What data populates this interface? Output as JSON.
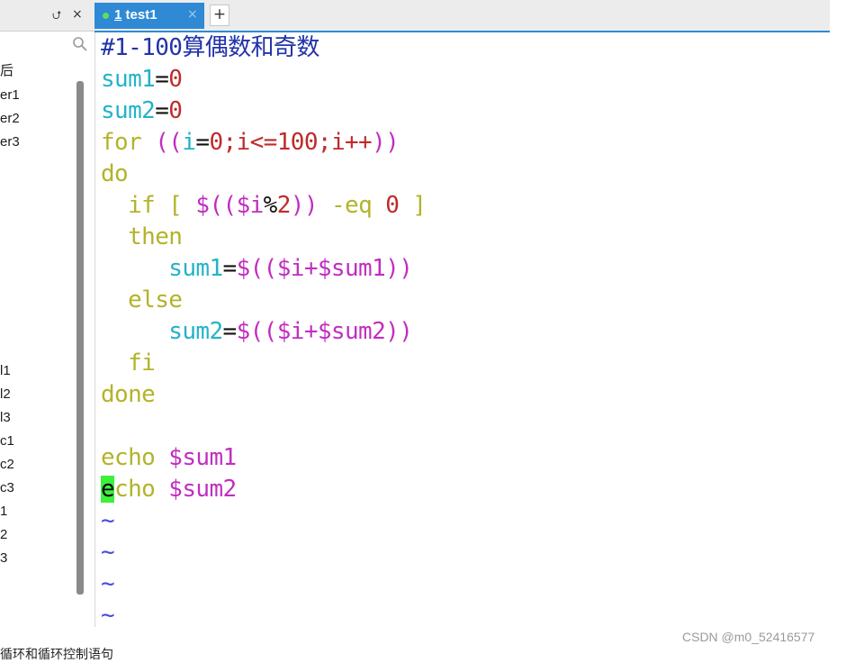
{
  "left_panel": {
    "pin_glyph": "⮍",
    "close_glyph": "×",
    "items": [
      {
        "label": "后"
      },
      {
        "label": "er1"
      },
      {
        "label": "er2"
      },
      {
        "label": "er3"
      },
      {
        "label": "l1"
      },
      {
        "label": "l2"
      },
      {
        "label": "l3"
      },
      {
        "label": "c1"
      },
      {
        "label": "c2"
      },
      {
        "label": "c3"
      },
      {
        "label": "1"
      },
      {
        "label": "2"
      },
      {
        "label": "3"
      }
    ]
  },
  "tab_bar": {
    "active_tab": {
      "number": "1",
      "name": "test1"
    },
    "close_glyph": "×",
    "new_tab_glyph": "+"
  },
  "editor": {
    "lines": [
      [
        {
          "t": "#1-100算偶数和奇数",
          "c": "comment"
        }
      ],
      [
        {
          "t": "sum1",
          "c": "var"
        },
        {
          "t": "=",
          "c": "op"
        },
        {
          "t": "0",
          "c": "num"
        }
      ],
      [
        {
          "t": "sum2",
          "c": "var"
        },
        {
          "t": "=",
          "c": "op"
        },
        {
          "t": "0",
          "c": "num"
        }
      ],
      [
        {
          "t": "for ",
          "c": "kw"
        },
        {
          "t": "((",
          "c": "sub"
        },
        {
          "t": "i",
          "c": "var"
        },
        {
          "t": "=",
          "c": "op"
        },
        {
          "t": "0",
          "c": "num"
        },
        {
          "t": ";i<=100;i++",
          "c": "num"
        },
        {
          "t": "))",
          "c": "sub"
        }
      ],
      [
        {
          "t": "do",
          "c": "kw"
        }
      ],
      [
        {
          "t": "  ",
          "c": "op"
        },
        {
          "t": "if [ ",
          "c": "kw"
        },
        {
          "t": "$((",
          "c": "sub"
        },
        {
          "t": "$i",
          "c": "sub"
        },
        {
          "t": "%",
          "c": "op"
        },
        {
          "t": "2",
          "c": "num"
        },
        {
          "t": "))",
          "c": "sub"
        },
        {
          "t": " -eq ",
          "c": "kw"
        },
        {
          "t": "0",
          "c": "num"
        },
        {
          "t": " ]",
          "c": "kw"
        }
      ],
      [
        {
          "t": "  ",
          "c": "op"
        },
        {
          "t": "then",
          "c": "kw"
        }
      ],
      [
        {
          "t": "     ",
          "c": "op"
        },
        {
          "t": "sum1",
          "c": "var"
        },
        {
          "t": "=",
          "c": "op"
        },
        {
          "t": "$(($i+$sum1))",
          "c": "sub"
        }
      ],
      [
        {
          "t": "  ",
          "c": "op"
        },
        {
          "t": "else",
          "c": "kw"
        }
      ],
      [
        {
          "t": "     ",
          "c": "op"
        },
        {
          "t": "sum2",
          "c": "var"
        },
        {
          "t": "=",
          "c": "op"
        },
        {
          "t": "$(($i+$sum2))",
          "c": "sub"
        }
      ],
      [
        {
          "t": "  ",
          "c": "op"
        },
        {
          "t": "fi",
          "c": "kw"
        }
      ],
      [
        {
          "t": "done",
          "c": "kw"
        }
      ],
      [],
      [
        {
          "t": "echo ",
          "c": "kw"
        },
        {
          "t": "$sum1",
          "c": "sub"
        }
      ],
      [
        {
          "t": "e",
          "c": "cursor"
        },
        {
          "t": "cho ",
          "c": "kw"
        },
        {
          "t": "$sum2",
          "c": "sub"
        }
      ],
      [
        {
          "t": "~",
          "c": "tilde"
        }
      ],
      [
        {
          "t": "~",
          "c": "tilde"
        }
      ],
      [
        {
          "t": "~",
          "c": "tilde"
        }
      ],
      [
        {
          "t": "~",
          "c": "tilde"
        }
      ]
    ]
  },
  "colors": {
    "comment": "#2233aa",
    "var": "#23b3c8",
    "op": "#111111",
    "num": "#c02a2a",
    "kw": "#b3b32a",
    "sub": "#c12ec1",
    "tilde": "#4a4ad8",
    "accent": "#2f89d4",
    "cursor_bg": "#3cf03c"
  },
  "watermark": "CSDN @m0_52416577",
  "bottom_text": "循环和循环控制语句"
}
